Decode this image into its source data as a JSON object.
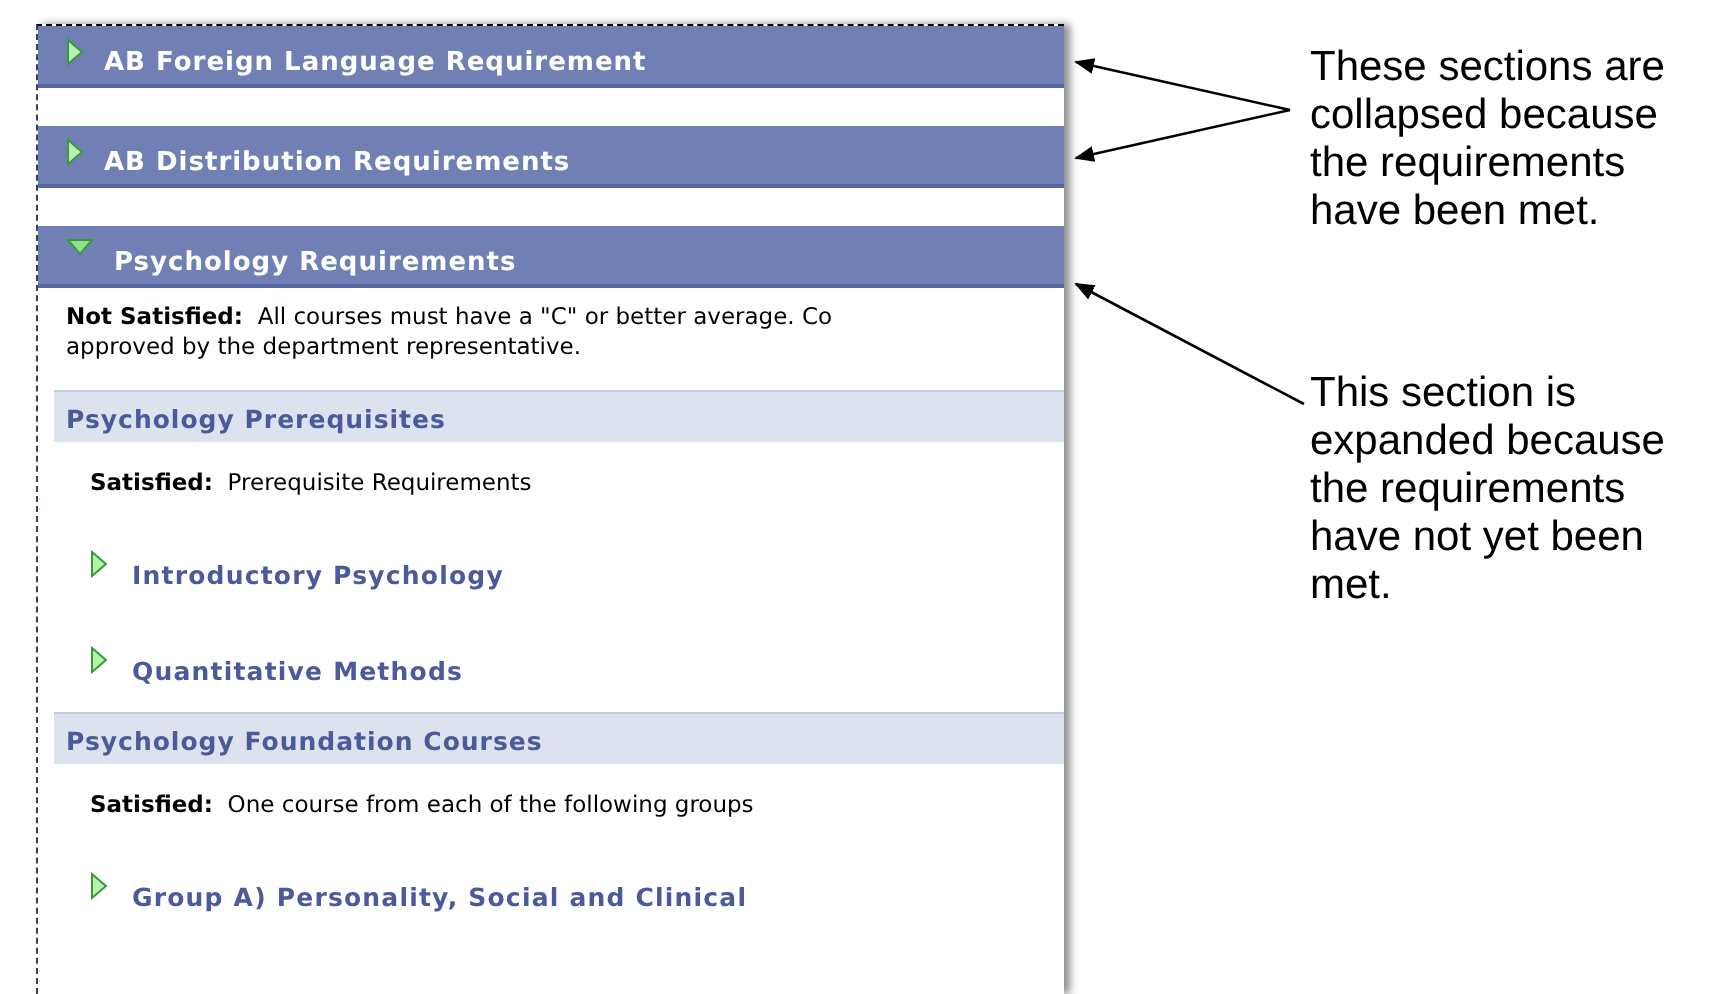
{
  "sections": [
    {
      "title": "AB Foreign Language Requirement",
      "expanded": false
    },
    {
      "title": "AB Distribution Requirements",
      "expanded": false
    },
    {
      "title": "Psychology Requirements",
      "expanded": true,
      "status": {
        "label": "Not Satisfied:",
        "lines": [
          "All courses must have a \"C\" or better average. Co",
          "approved by the department representative."
        ]
      },
      "groups": [
        {
          "title": "Psychology Prerequisites",
          "status": {
            "label": "Satisfied:",
            "text": "Prerequisite Requirements"
          },
          "items": [
            {
              "title": "Introductory Psychology",
              "expanded": false
            },
            {
              "title": "Quantitative Methods",
              "expanded": false
            }
          ]
        },
        {
          "title": "Psychology Foundation Courses",
          "status": {
            "label": "Satisfied:",
            "text": "One course from each of the following groups"
          },
          "items": [
            {
              "title": "Group A) Personality, Social and Clinical",
              "expanded": false
            }
          ]
        }
      ]
    }
  ],
  "annotations": [
    {
      "lines": [
        "These sections are",
        "collapsed because",
        "the requirements",
        "have been met."
      ]
    },
    {
      "lines": [
        "This section is",
        "expanded because",
        "the requirements",
        "have not yet been",
        "met."
      ]
    }
  ]
}
